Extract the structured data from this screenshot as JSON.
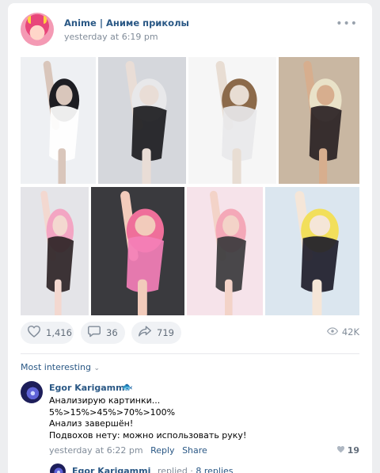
{
  "post": {
    "group_name": "Anime | Аниме приколы",
    "time": "yesterday at 6:19 pm",
    "more_label": "•••"
  },
  "gallery": {
    "photos": [
      {
        "bg": "#eef0f3",
        "figure": "#d9c6bb",
        "hair": "#1d1d22",
        "outfit": "#ffffff"
      },
      {
        "bg": "#d5d7dc",
        "figure": "#e9ddd6",
        "hair": "#e8e8ea",
        "outfit": "#1c1c20"
      },
      {
        "bg": "#f6f6f6",
        "figure": "#e8ddd3",
        "hair": "#8c6a4a",
        "outfit": "#e8e8ea"
      },
      {
        "bg": "#c9b7a2",
        "figure": "#d7ae8e",
        "hair": "#e9e2c8",
        "outfit": "#2a2224"
      },
      {
        "bg": "#e4e4e8",
        "figure": "#f3d8d0",
        "hair": "#f3a5c3",
        "outfit": "#2e2426"
      },
      {
        "bg": "#3a3a3e",
        "figure": "#f2cbbb",
        "hair": "#ef6f9a",
        "outfit": "#f47fb7"
      },
      {
        "bg": "#f6e3ea",
        "figure": "#f3d3c8",
        "hair": "#f4a8b8",
        "outfit": "#3a3a3c"
      },
      {
        "bg": "#dbe6ef",
        "figure": "#f5e6d8",
        "hair": "#f2df5b",
        "outfit": "#1e1d2a"
      }
    ]
  },
  "actions": {
    "likes": "1,416",
    "comments": "36",
    "shares": "719",
    "views": "42K"
  },
  "comments_section": {
    "sort_label": "Most interesting",
    "comment": {
      "author": "Egor Karigammi",
      "emoji": "🐟",
      "lines": [
        "Анализирую картинки...",
        "5%>15%>45%>70%>100%",
        "Анализ завершён!",
        "Подвохов нету: можно использовать руку!"
      ],
      "time": "yesterday at 6:22 pm",
      "reply_label": "Reply",
      "share_label": "Share",
      "likes": "19"
    },
    "replies": {
      "author": "Egor Karigammi",
      "action": "replied ·",
      "count_label": "8 replies"
    }
  },
  "colors": {
    "link": "#2a5885",
    "muted": "#818c99",
    "pill_bg": "#f0f2f5"
  }
}
